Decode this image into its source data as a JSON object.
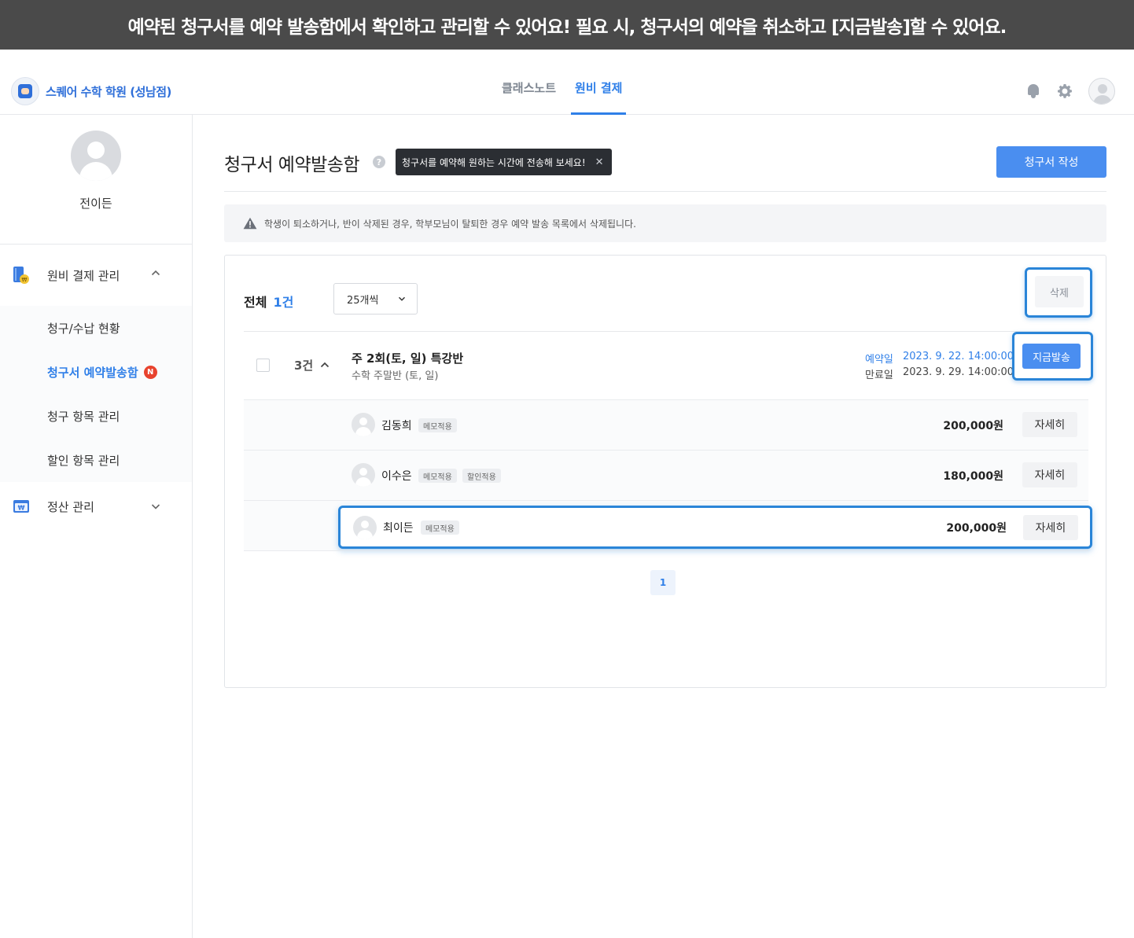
{
  "banner": {
    "text": "예약된 청구서를 예약 발송함에서 확인하고 관리할 수 있어요! 필요 시, 청구서의 예약을 취소하고 [지금발송]할 수 있어요."
  },
  "header": {
    "academy_name": "스퀘어 수학 학원 (성남점)",
    "tabs": [
      {
        "label": "클래스노트",
        "active": false
      },
      {
        "label": "원비 결제",
        "active": true
      }
    ],
    "icons": [
      "bell-icon",
      "gear-icon",
      "avatar"
    ]
  },
  "sidebar": {
    "user_name": "전이든",
    "groups": [
      {
        "label": "원비 결제 관리",
        "expanded": true,
        "items": [
          {
            "label": "청구/수납 현황",
            "active": false
          },
          {
            "label": "청구서 예약발송함",
            "active": true,
            "badge": "N"
          },
          {
            "label": "청구 항목 관리",
            "active": false
          },
          {
            "label": "할인 항목 관리",
            "active": false
          }
        ]
      },
      {
        "label": "정산 관리",
        "expanded": false,
        "items": []
      }
    ]
  },
  "main": {
    "title": "청구서 예약발송함",
    "help_glyph": "?",
    "tooltip": "청구서를 예약해 원하는 시간에 전송해 보세요!",
    "create_button": "청구서 작성",
    "notice": "학생이 퇴소하거나, 반이 삭제된 경우, 학부모님이 탈퇴한 경우 예약 발송 목록에서 삭제됩니다.",
    "list": {
      "total_label": "전체",
      "total_count": "1건",
      "per_page": "25개씩",
      "delete_button": "삭제",
      "group": {
        "count": "3건",
        "title": "주 2회(토, 일) 특강반",
        "subtitle": "수학 주말반 (토, 일)",
        "reserve_label": "예약일",
        "reserve_date": "2023. 9. 22. 14:00:00",
        "expire_label": "만료일",
        "expire_date": "2023. 9. 29. 14:00:00",
        "send_button": "지금발송"
      },
      "students": [
        {
          "name": "김동희",
          "tags": [
            "메모적용"
          ],
          "amount": "200,000원",
          "detail_button": "자세히"
        },
        {
          "name": "이수은",
          "tags": [
            "메모적용",
            "할인적용"
          ],
          "amount": "180,000원",
          "detail_button": "자세히"
        },
        {
          "name": "최이든",
          "tags": [
            "메모적용"
          ],
          "amount": "200,000원",
          "detail_button": "자세히"
        }
      ],
      "pagination": {
        "current": "1"
      }
    }
  },
  "colors": {
    "accent": "#2f7fe8",
    "primary_button": "#4a8ef0",
    "highlight": "#2a85d8",
    "banner_bg": "#4a4a4a",
    "badge": "#e8432e"
  }
}
